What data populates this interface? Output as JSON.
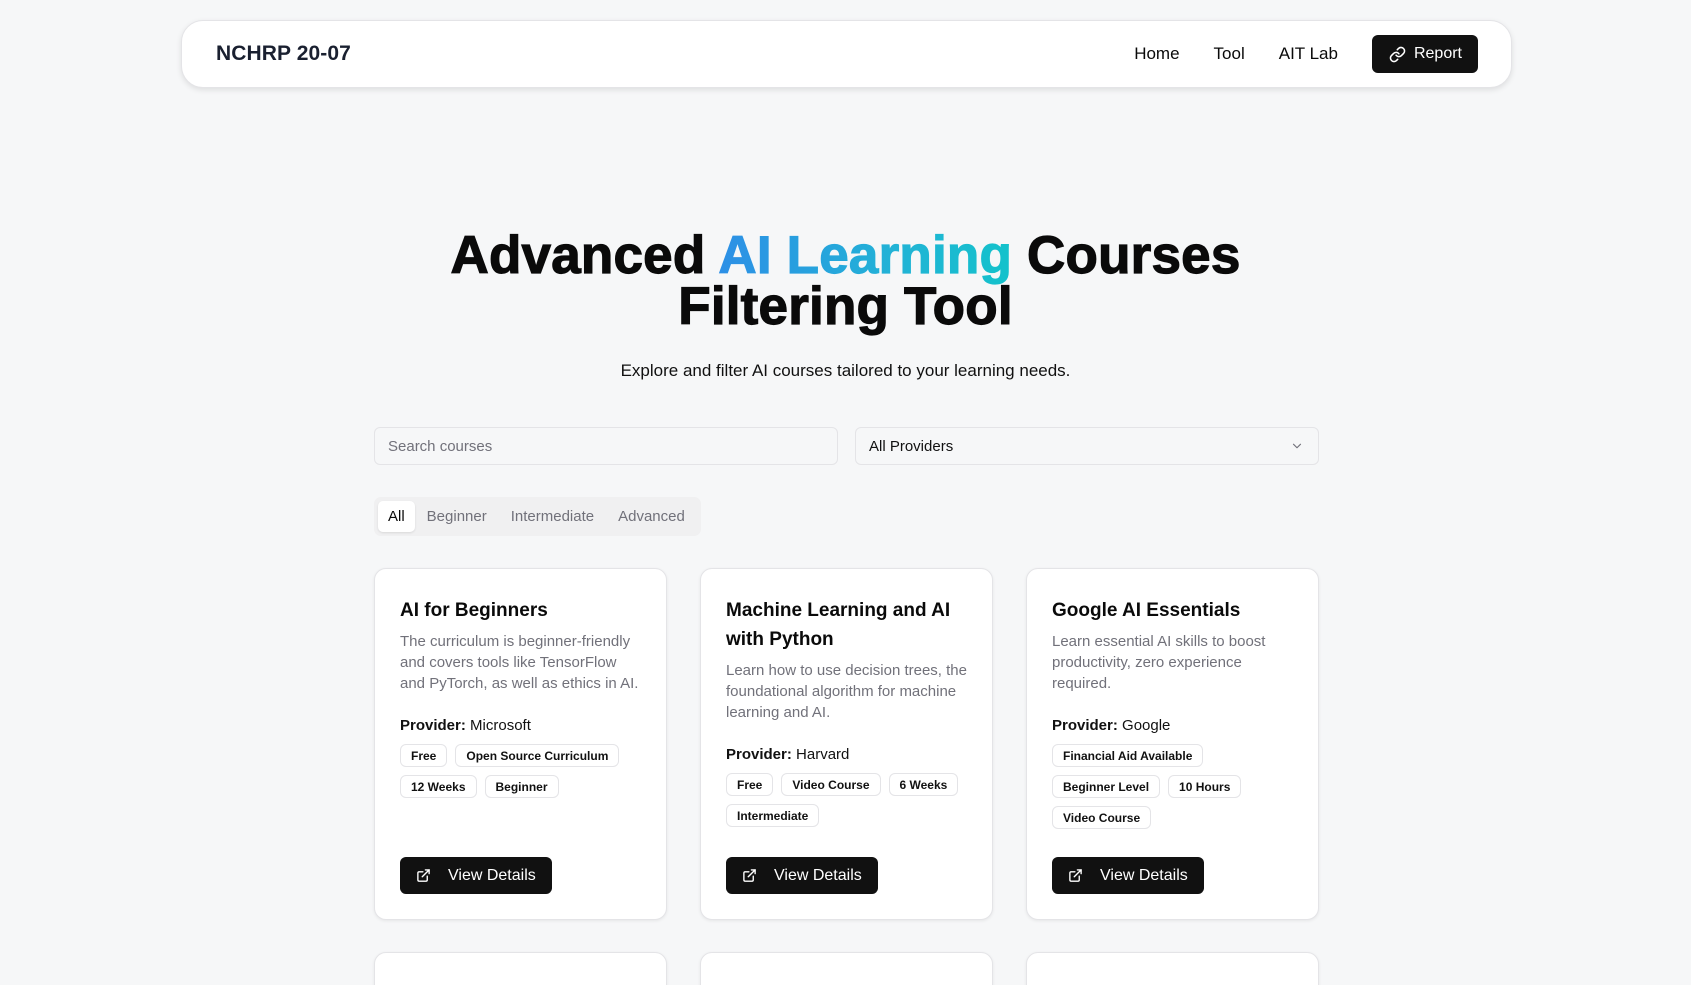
{
  "navbar": {
    "brand": "NCHRP 20-07",
    "links": [
      "Home",
      "Tool",
      "AIT Lab"
    ],
    "report_label": "Report",
    "report_icon": "link-icon"
  },
  "hero": {
    "title_part1": "Advanced ",
    "title_highlight": "AI Learning",
    "title_part2": " Courses",
    "title_line2": "Filtering Tool",
    "subtitle": "Explore and filter AI courses tailored to your learning needs.",
    "highlight_gradient": [
      "#2d8fe6",
      "#13c2cb"
    ]
  },
  "filters": {
    "search_placeholder": "Search courses",
    "search_value": "",
    "provider_selected": "All Providers",
    "tabs": [
      "All",
      "Beginner",
      "Intermediate",
      "Advanced"
    ],
    "active_tab": "All"
  },
  "courses": [
    {
      "title": "AI for Beginners",
      "description": "The curriculum is beginner-friendly and covers tools like TensorFlow and PyTorch, as well as ethics in AI.",
      "provider_label": "Provider:",
      "provider": "Microsoft",
      "tags": [
        "Free",
        "Open Source Curriculum",
        "12 Weeks",
        "Beginner"
      ],
      "button_label": "View Details"
    },
    {
      "title": "Machine Learning and AI with Python",
      "description": "Learn how to use decision trees, the foundational algorithm for machine learning and AI.",
      "provider_label": "Provider:",
      "provider": "Harvard",
      "tags": [
        "Free",
        "Video Course",
        "6 Weeks",
        "Intermediate"
      ],
      "button_label": "View Details"
    },
    {
      "title": "Google AI Essentials",
      "description": "Learn essential AI skills to boost productivity, zero experience required.",
      "provider_label": "Provider:",
      "provider": "Google",
      "tags": [
        "Financial Aid Available",
        "Beginner Level",
        "10 Hours",
        "Video Course"
      ],
      "button_label": "View Details"
    }
  ]
}
